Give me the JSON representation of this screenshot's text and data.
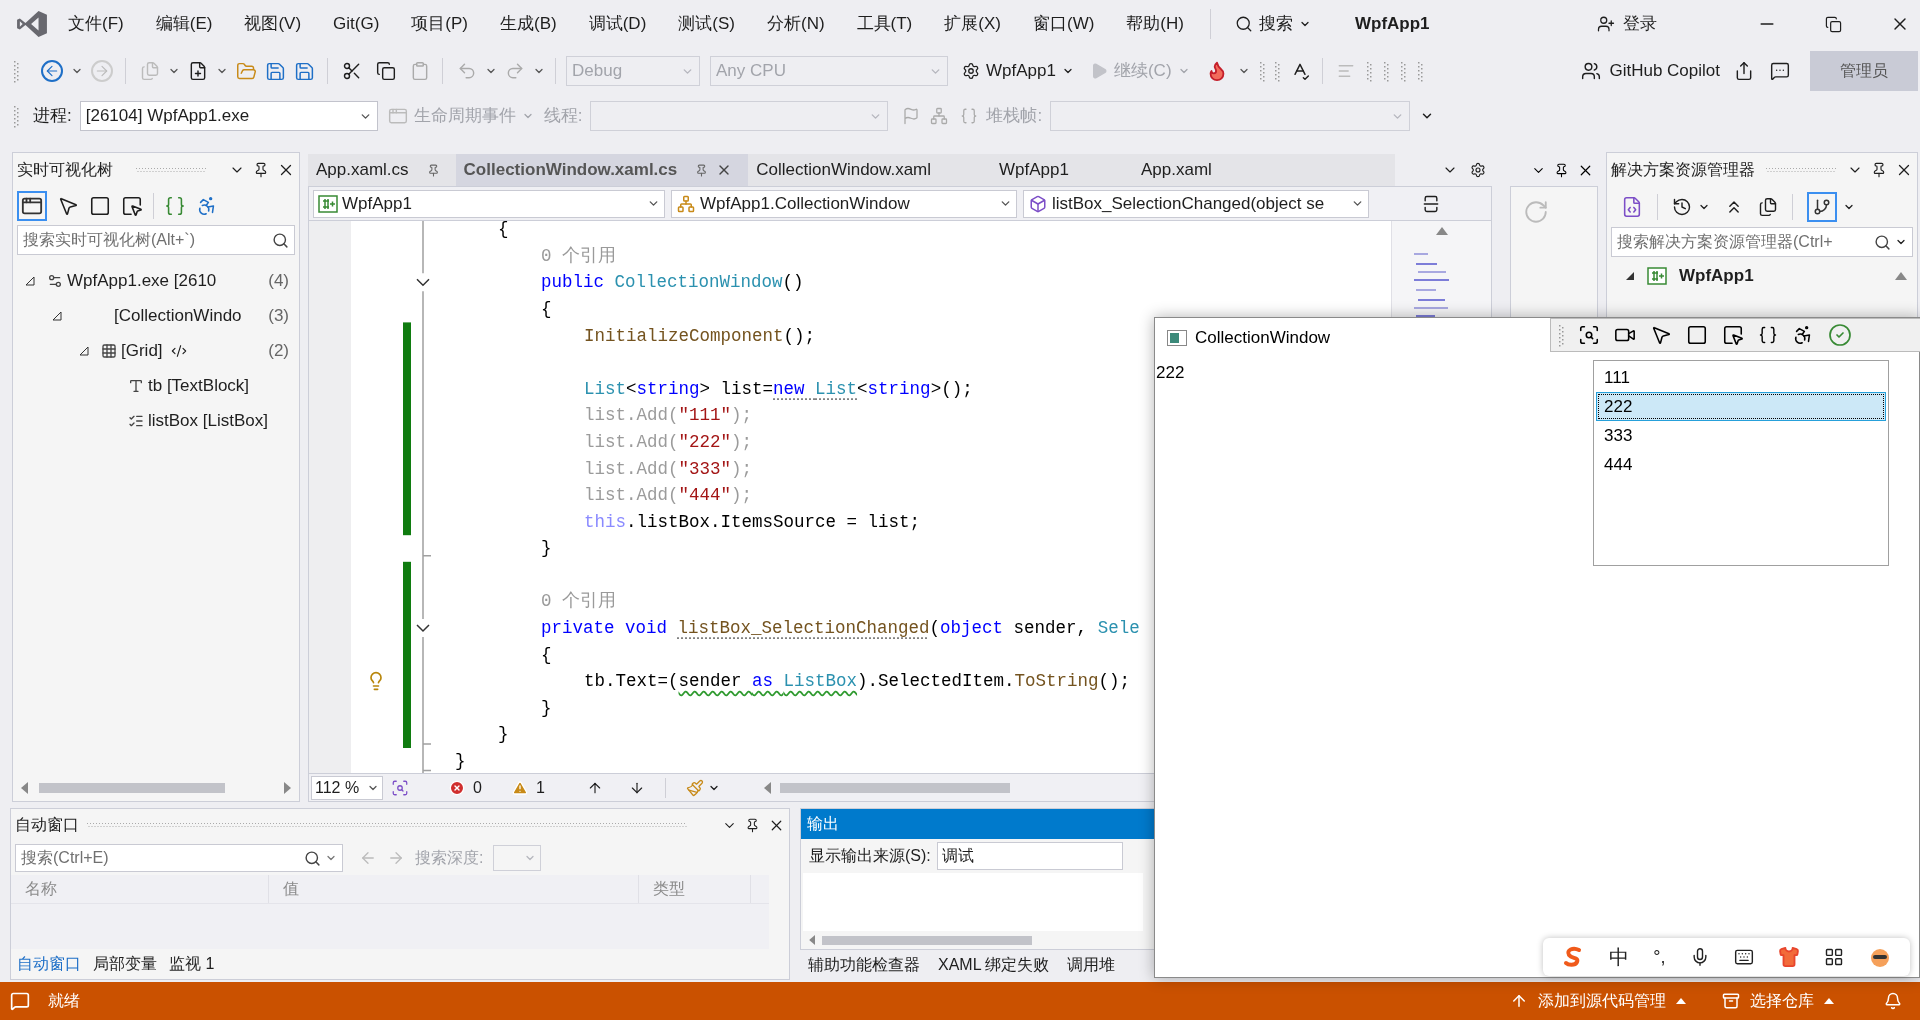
{
  "menu": {
    "items": [
      "文件(F)",
      "编辑(E)",
      "视图(V)",
      "Git(G)",
      "项目(P)",
      "生成(B)",
      "调试(D)",
      "测试(S)",
      "分析(N)",
      "工具(T)",
      "扩展(X)",
      "窗口(W)",
      "帮助(H)"
    ],
    "search": "搜索",
    "title": "WpfApp1",
    "login": "登录"
  },
  "toolbar": {
    "configuration": {
      "label": "Debug",
      "disabled": true
    },
    "platform": {
      "label": "Any CPU",
      "disabled": true
    },
    "startup": "WpfApp1",
    "continue": {
      "label": "继续(C)",
      "disabled": true
    },
    "copilot": "GitHub Copilot",
    "admin": "管理员"
  },
  "debug_location": {
    "process_label": "进程:",
    "process": "[26104] WpfApp1.exe",
    "lifecycle": {
      "label": "生命周期事件",
      "disabled": true
    },
    "thread_label": "线程:",
    "stack_label": "堆栈帧:"
  },
  "live_tree": {
    "title": "实时可视化树",
    "search": {
      "placeholder": "搜索实时可视化树(Alt+`)"
    },
    "items": [
      {
        "kind": "process",
        "label": "WpfApp1.exe [2610",
        "count": "(4)",
        "expanded": true,
        "children": [
          {
            "kind": "window",
            "label": "[CollectionWindo",
            "count": "(3)",
            "expanded": true,
            "children": [
              {
                "kind": "grid",
                "label": "[Grid]",
                "count": "(2)",
                "expanded": true,
                "children": [
                  {
                    "kind": "textblock",
                    "label": "tb [TextBlock]"
                  },
                  {
                    "kind": "listbox",
                    "label": "listBox [ListBox]"
                  }
                ]
              }
            ]
          }
        ]
      }
    ]
  },
  "editor": {
    "tabs": [
      {
        "label": "App.xaml.cs",
        "selected": false,
        "pinned": true
      },
      {
        "label": "CollectionWindow.xaml.cs",
        "selected": true,
        "pinned": true
      },
      {
        "label": "CollectionWindow.xaml",
        "selected": false,
        "pinned": false
      },
      {
        "label": "WpfApp1",
        "selected": false,
        "pinned": false
      },
      {
        "label": "App.xaml",
        "selected": false,
        "pinned": false
      }
    ],
    "nav": [
      "WpfApp1",
      "WpfApp1.CollectionWindow",
      "listBox_SelectionChanged(object se"
    ],
    "lines": [
      {
        "kind": "group",
        "children": [
          {
            "kind": "code",
            "tokens": [
              {
                "text": "{",
                "kind": "plain"
              }
            ],
            "children": [
              {
                "kind": "codelens",
                "text": "0 个引用"
              },
              {
                "kind": "code",
                "tokens": [
                  {
                    "text": "public ",
                    "kind": "keyword"
                  },
                  {
                    "text": "CollectionWindow",
                    "kind": "type"
                  },
                  {
                    "text": "()",
                    "kind": "plain"
                  }
                ]
              },
              {
                "kind": "code",
                "tokens": [
                  {
                    "text": "{",
                    "kind": "plain"
                  }
                ],
                "children": [
                  {
                    "kind": "code",
                    "tokens": [
                      {
                        "text": "InitializeComponent",
                        "kind": "method"
                      },
                      {
                        "text": "();",
                        "kind": "plain"
                      }
                    ]
                  },
                  {
                    "kind": "blank"
                  },
                  {
                    "kind": "code",
                    "tokens": [
                      {
                        "text": "List",
                        "kind": "type"
                      },
                      {
                        "text": "<",
                        "kind": "plain"
                      },
                      {
                        "text": "string",
                        "kind": "keyword"
                      },
                      {
                        "text": "> list=",
                        "kind": "plain"
                      },
                      {
                        "text": "new ",
                        "kind": "keyword",
                        "dotted_underline": true
                      },
                      {
                        "text": "List",
                        "kind": "type",
                        "dotted_underline": true
                      },
                      {
                        "text": "<",
                        "kind": "plain"
                      },
                      {
                        "text": "string",
                        "kind": "keyword"
                      },
                      {
                        "text": ">();",
                        "kind": "plain"
                      }
                    ]
                  },
                  {
                    "kind": "code",
                    "tokens": [
                      {
                        "text": "list.Add(",
                        "kind": "faded"
                      },
                      {
                        "text": "\"111\"",
                        "kind": "string"
                      },
                      {
                        "text": ");",
                        "kind": "faded"
                      }
                    ]
                  },
                  {
                    "kind": "code",
                    "tokens": [
                      {
                        "text": "list.Add(",
                        "kind": "faded"
                      },
                      {
                        "text": "\"222\"",
                        "kind": "string"
                      },
                      {
                        "text": ");",
                        "kind": "faded"
                      }
                    ]
                  },
                  {
                    "kind": "code",
                    "tokens": [
                      {
                        "text": "list.Add(",
                        "kind": "faded"
                      },
                      {
                        "text": "\"333\"",
                        "kind": "string"
                      },
                      {
                        "text": ");",
                        "kind": "faded"
                      }
                    ]
                  },
                  {
                    "kind": "code",
                    "tokens": [
                      {
                        "text": "list.Add(",
                        "kind": "faded"
                      },
                      {
                        "text": "\"444\"",
                        "kind": "string"
                      },
                      {
                        "text": ");",
                        "kind": "faded"
                      }
                    ]
                  },
                  {
                    "kind": "code",
                    "tokens": [
                      {
                        "text": "this",
                        "kind": "faded_keyword"
                      },
                      {
                        "text": ".listBox.ItemsSource = list;",
                        "kind": "plain"
                      }
                    ]
                  }
                ]
              },
              {
                "kind": "code",
                "tokens": [
                  {
                    "text": "}",
                    "kind": "plain"
                  }
                ]
              },
              {
                "kind": "blank"
              },
              {
                "kind": "codelens",
                "text": "0 个引用"
              },
              {
                "kind": "code",
                "tokens": [
                  {
                    "text": "private void ",
                    "kind": "keyword"
                  },
                  {
                    "text": "listBox_SelectionChanged",
                    "kind": "method",
                    "dotted_underline": true
                  },
                  {
                    "text": "(",
                    "kind": "plain"
                  },
                  {
                    "text": "object ",
                    "kind": "keyword"
                  },
                  {
                    "text": "sender, ",
                    "kind": "plain"
                  },
                  {
                    "text": "Sele",
                    "kind": "type"
                  }
                ]
              },
              {
                "kind": "code",
                "tokens": [
                  {
                    "text": "{",
                    "kind": "plain"
                  }
                ],
                "children": [
                  {
                    "kind": "code",
                    "lightbulb": true,
                    "tokens": [
                      {
                        "text": "tb.Text=(",
                        "kind": "plain"
                      },
                      {
                        "text": "sender ",
                        "kind": "plain",
                        "wavy_underline": true
                      },
                      {
                        "text": "as ",
                        "kind": "keyword",
                        "wavy_underline": true
                      },
                      {
                        "text": "ListBox",
                        "kind": "type",
                        "wavy_underline": true
                      },
                      {
                        "text": ").SelectedItem.",
                        "kind": "plain"
                      },
                      {
                        "text": "ToString",
                        "kind": "method"
                      },
                      {
                        "text": "();",
                        "kind": "plain"
                      }
                    ]
                  }
                ]
              },
              {
                "kind": "code",
                "tokens": [
                  {
                    "text": "}",
                    "kind": "plain"
                  }
                ]
              }
            ]
          },
          {
            "kind": "code",
            "tokens": [
              {
                "text": "}",
                "kind": "plain"
              }
            ]
          }
        ]
      },
      {
        "kind": "code",
        "tokens": [
          {
            "text": "}",
            "kind": "plain"
          }
        ]
      }
    ],
    "zoom": "112 %",
    "errors": "0",
    "warnings": "1"
  },
  "solution_explorer": {
    "title": "解决方案资源管理器",
    "search": {
      "placeholder": "搜索解决方案资源管理器(Ctrl+"
    },
    "items": [
      {
        "label": "WpfApp1",
        "expanded": true
      }
    ]
  },
  "app_window": {
    "title": "CollectionWindow",
    "text": "222",
    "list": [
      {
        "label": "111",
        "selected": false
      },
      {
        "label": "222",
        "selected": true
      },
      {
        "label": "333",
        "selected": false
      },
      {
        "label": "444",
        "selected": false
      }
    ]
  },
  "autos": {
    "title": "自动窗口",
    "search": {
      "placeholder": "搜索(Ctrl+E)"
    },
    "depth_label": "搜索深度:",
    "columns": [
      "名称",
      "值",
      "类型"
    ],
    "tabs": [
      {
        "label": "自动窗口",
        "selected": true
      },
      {
        "label": "局部变量",
        "selected": false
      },
      {
        "label": "监视 1",
        "selected": false
      }
    ]
  },
  "output": {
    "title": "输出",
    "source_label": "显示输出来源(S):",
    "source": "调试",
    "tabs": [
      "辅助功能检查器",
      "XAML 绑定失败",
      "调用堆"
    ]
  },
  "ime": {
    "mode": "中",
    "punctuation": "°,"
  },
  "status_bar": {
    "text": "就绪",
    "source_control": "添加到源代码管理",
    "repository": "选择仓库"
  }
}
